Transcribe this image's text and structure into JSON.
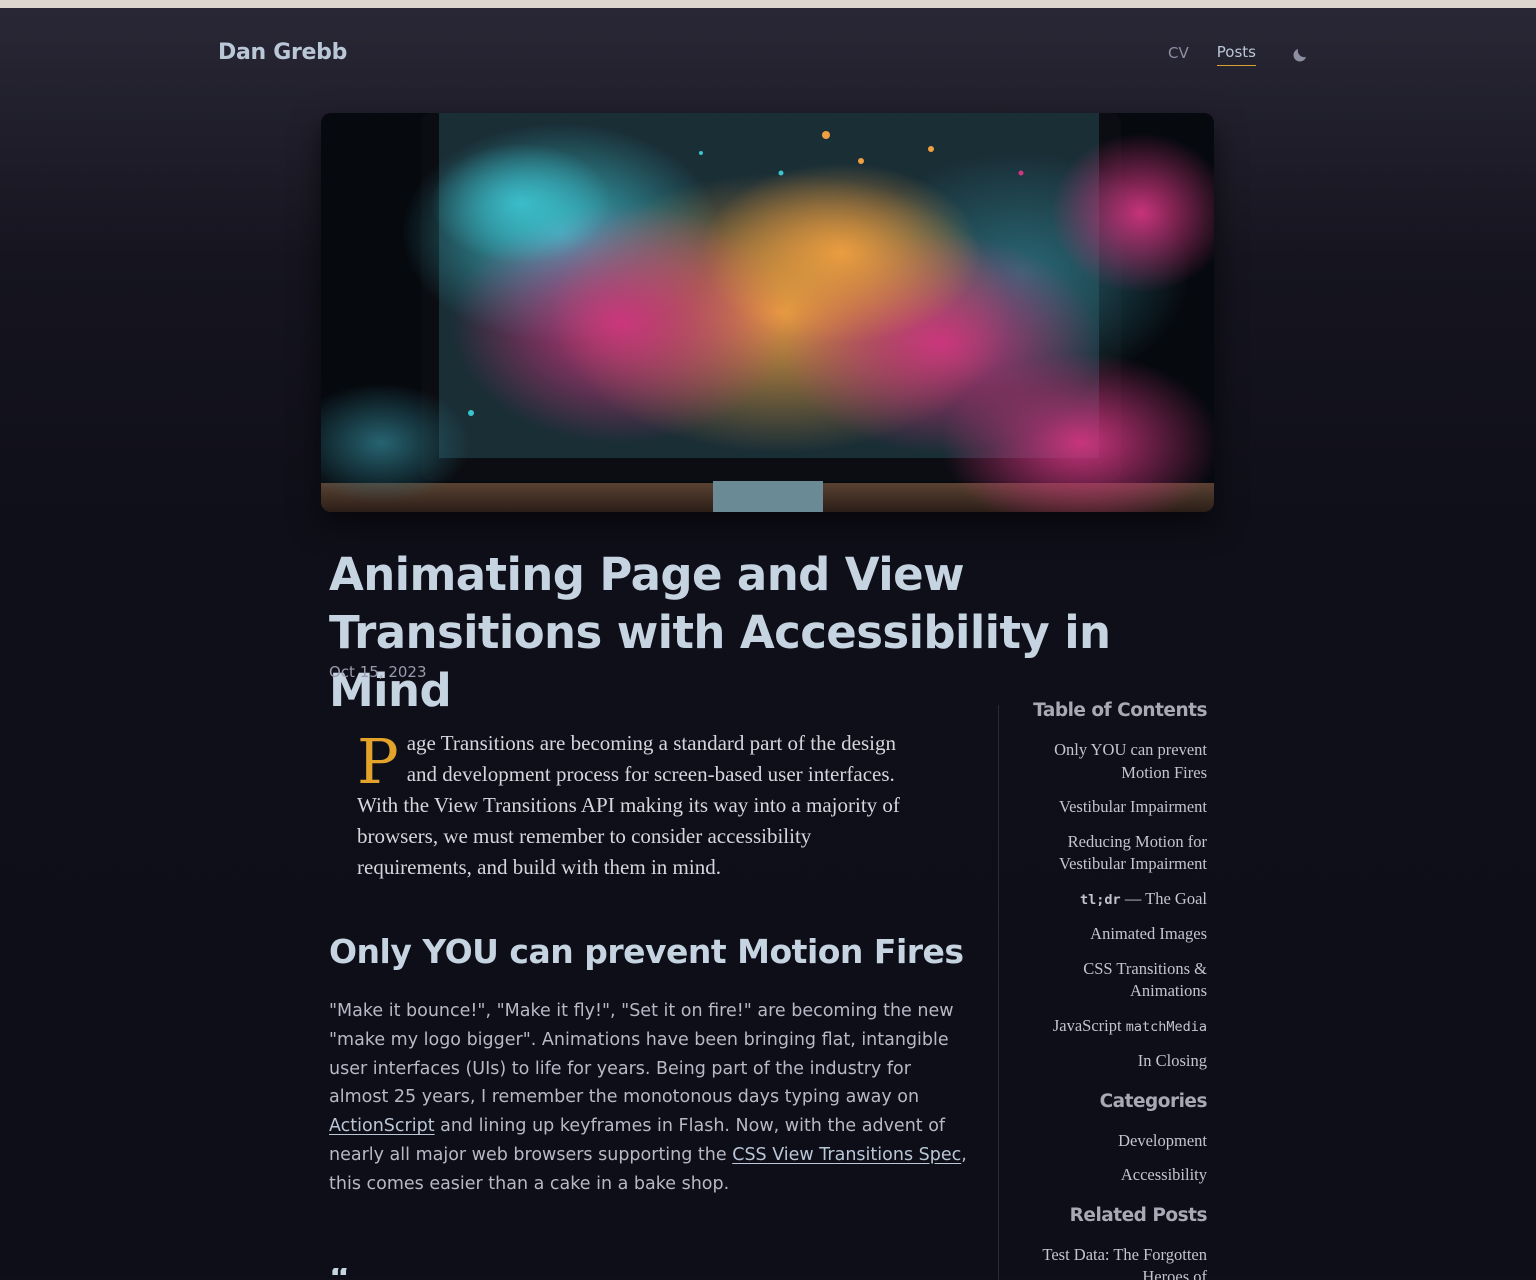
{
  "site": {
    "title": "Dan Grebb"
  },
  "nav": {
    "items": [
      {
        "label": "CV"
      },
      {
        "label": "Posts"
      }
    ]
  },
  "post": {
    "title": "Animating Page and View Transitions with Accessibility in Mind",
    "date": "Oct 15, 2023",
    "lead_dropcap": "P",
    "lead_rest": "age Transitions are becoming a standard part of the design and development process for screen-based user interfaces. With the View Transitions API making its way into a majority of browsers, we must remember to consider accessibility requirements, and build with them in mind.",
    "section_heading": "Only YOU can prevent Motion Fires",
    "para_1": "\"Make it bounce!\", \"Make it fly!\", \"Set it on fire!\" are becoming the new \"make my logo bigger\". Animations have been bringing flat, intangible user interfaces (UIs) to life for years. Being part of the industry for almost 25 years, I remember the monotonous days typing away on ",
    "link_1": "ActionScript",
    "para_2": " and lining up keyframes in Flash. Now, with the advent of nearly all major web browsers supporting the ",
    "link_2": "CSS View Transitions Spec",
    "para_3": ", this comes easier than a cake in a bake shop.",
    "next_heading_fragment": "“"
  },
  "sidebar": {
    "toc_heading": "Table of Contents",
    "toc": [
      {
        "label": "Only YOU can prevent Motion Fires"
      },
      {
        "label": "Vestibular Impairment"
      },
      {
        "label": "Reducing Motion for Vestibular Impairment"
      },
      {
        "code": "tl;dr",
        "label": " — The Goal"
      },
      {
        "label": "Animated Images"
      },
      {
        "label": "CSS Transitions & Animations"
      },
      {
        "label": "JavaScript ",
        "code": "matchMedia"
      },
      {
        "label": "In Closing"
      }
    ],
    "categories_heading": "Categories",
    "categories": [
      {
        "label": "Development"
      },
      {
        "label": "Accessibility"
      }
    ],
    "related_heading": "Related Posts",
    "related": [
      {
        "label": "Test Data: The Forgotten Heroes of"
      }
    ]
  },
  "icons": {
    "theme_toggle": "moon-icon"
  },
  "colors": {
    "accent": "#e3a22a",
    "title": "#c6d4e2",
    "background": "#0f0f1a"
  }
}
